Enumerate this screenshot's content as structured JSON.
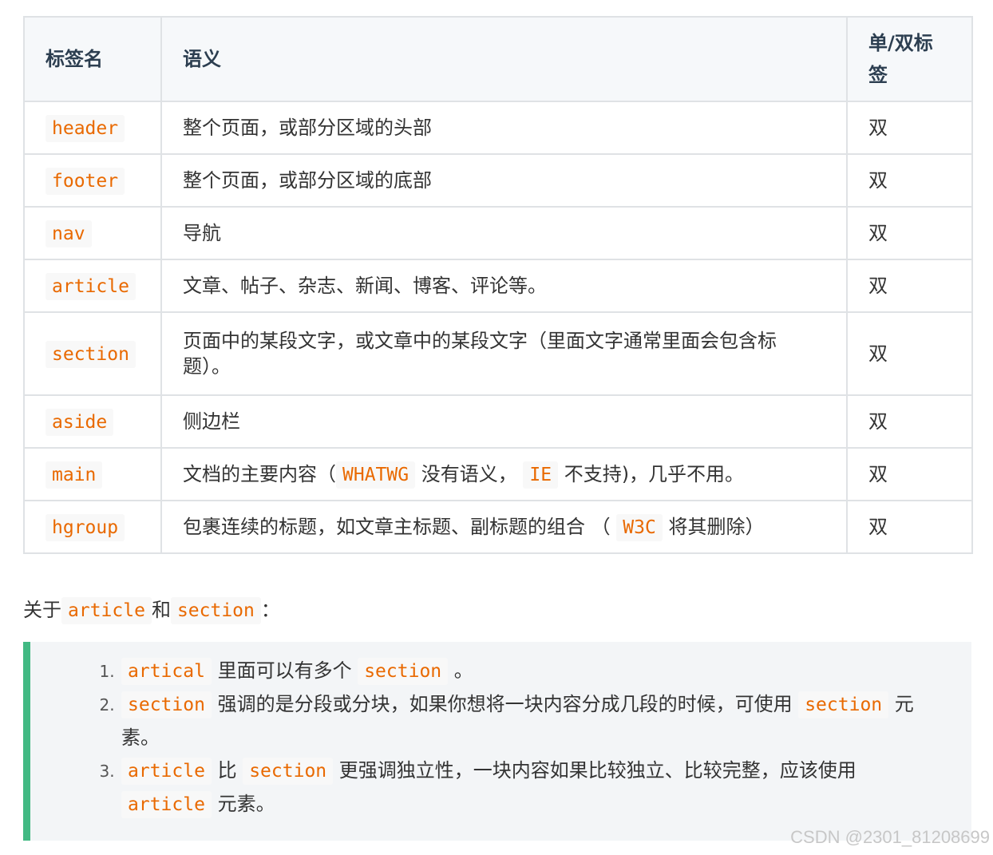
{
  "table": {
    "headers": [
      "标签名",
      "语义",
      "单/双标签"
    ],
    "rows": [
      {
        "tag": "header",
        "semantic": [
          {
            "t": "text",
            "v": "整个页面，或部分区域的头部"
          }
        ],
        "type": "双"
      },
      {
        "tag": "footer",
        "semantic": [
          {
            "t": "text",
            "v": "整个页面，或部分区域的底部"
          }
        ],
        "type": "双"
      },
      {
        "tag": "nav",
        "semantic": [
          {
            "t": "text",
            "v": "导航"
          }
        ],
        "type": "双"
      },
      {
        "tag": "article",
        "semantic": [
          {
            "t": "text",
            "v": "文章、帖子、杂志、新闻、博客、评论等。"
          }
        ],
        "type": "双"
      },
      {
        "tag": "section",
        "semantic": [
          {
            "t": "text",
            "v": "页面中的某段文字，或文章中的某段文字（里面文字通常里面会包含标题）。"
          }
        ],
        "type": "双",
        "tall": true
      },
      {
        "tag": "aside",
        "semantic": [
          {
            "t": "text",
            "v": "侧边栏"
          }
        ],
        "type": "双"
      },
      {
        "tag": "main",
        "semantic": [
          {
            "t": "text",
            "v": "文档的主要内容（"
          },
          {
            "t": "code",
            "v": "WHATWG"
          },
          {
            "t": "text",
            "v": " 没有语义， "
          },
          {
            "t": "code",
            "v": "IE"
          },
          {
            "t": "text",
            "v": " 不支持)，几乎不用。"
          }
        ],
        "type": "双"
      },
      {
        "tag": "hgroup",
        "semantic": [
          {
            "t": "text",
            "v": "包裹连续的标题，如文章主标题、副标题的组合 （ "
          },
          {
            "t": "code",
            "v": "W3C"
          },
          {
            "t": "text",
            "v": " 将其删除）"
          }
        ],
        "type": "双"
      }
    ]
  },
  "about": [
    {
      "t": "text",
      "v": "关于"
    },
    {
      "t": "code",
      "v": "article"
    },
    {
      "t": "text",
      "v": "和"
    },
    {
      "t": "code",
      "v": "section"
    },
    {
      "t": "text",
      "v": "："
    }
  ],
  "tips": [
    [
      {
        "t": "code",
        "v": "artical"
      },
      {
        "t": "text",
        "v": " 里面可以有多个 "
      },
      {
        "t": "code",
        "v": "section"
      },
      {
        "t": "text",
        "v": " 。"
      }
    ],
    [
      {
        "t": "code",
        "v": "section"
      },
      {
        "t": "text",
        "v": " 强调的是分段或分块，如果你想将一块内容分成几段的时候，可使用 "
      },
      {
        "t": "code",
        "v": "section"
      },
      {
        "t": "text",
        "v": " 元素。"
      }
    ],
    [
      {
        "t": "code",
        "v": "article"
      },
      {
        "t": "text",
        "v": " 比 "
      },
      {
        "t": "code",
        "v": "section"
      },
      {
        "t": "text",
        "v": " 更强调独立性，一块内容如果比较独立、比较完整，应该使用 "
      },
      {
        "t": "code",
        "v": "article"
      },
      {
        "t": "text",
        "v": " 元素。"
      }
    ]
  ],
  "watermark": "CSDN @2301_81208699"
}
